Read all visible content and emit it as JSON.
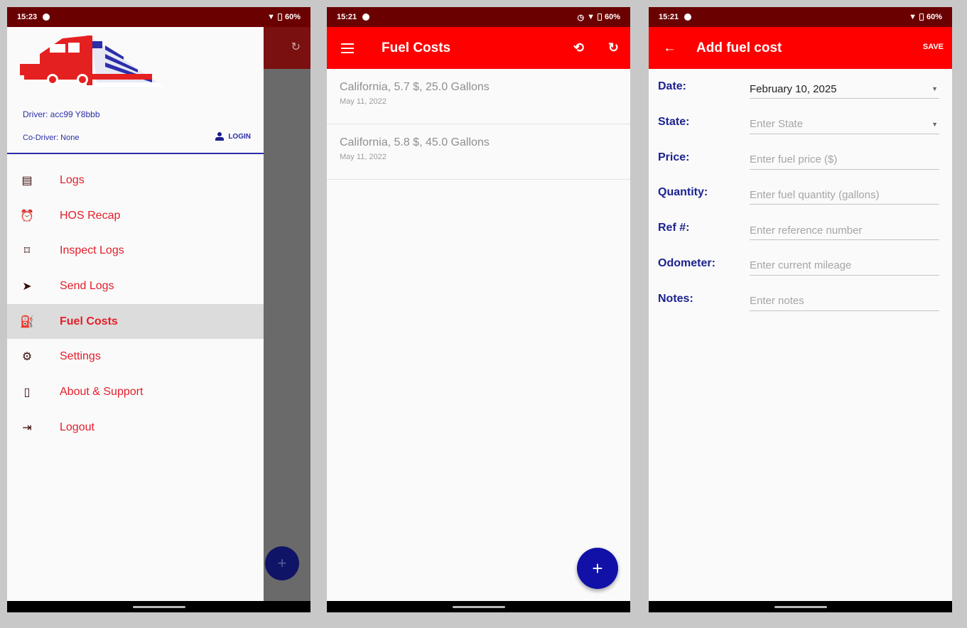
{
  "screens": [
    {
      "status": {
        "time": "15:23",
        "battery": "60%"
      },
      "drawer": {
        "driver": "Driver: acc99 Y8bbb",
        "codriver": "Co-Driver: None",
        "login_label": "LOGIN",
        "items": [
          {
            "label": "Logs",
            "icon": "logs-icon"
          },
          {
            "label": "HOS Recap",
            "icon": "alarm-clock-icon"
          },
          {
            "label": "Inspect Logs",
            "icon": "inspect-icon"
          },
          {
            "label": "Send Logs",
            "icon": "send-icon"
          },
          {
            "label": "Fuel Costs",
            "icon": "fuel-pump-icon",
            "active": true
          },
          {
            "label": "Settings",
            "icon": "gear-icon"
          },
          {
            "label": "About & Support",
            "icon": "phone-device-icon"
          },
          {
            "label": "Logout",
            "icon": "logout-icon"
          }
        ]
      }
    },
    {
      "status": {
        "time": "15:21",
        "battery": "60%"
      },
      "appbar": {
        "title": "Fuel Costs"
      },
      "entries": [
        {
          "title": "California, 5.7 $, 25.0 Gallons",
          "date": "May 11, 2022"
        },
        {
          "title": "California, 5.8 $, 45.0 Gallons",
          "date": "May 11, 2022"
        }
      ],
      "fab": "+"
    },
    {
      "status": {
        "time": "15:21",
        "battery": "60%"
      },
      "appbar": {
        "title": "Add fuel cost",
        "save_label": "SAVE"
      },
      "form": {
        "date": {
          "label": "Date:",
          "value": "February 10, 2025"
        },
        "state": {
          "label": "State:",
          "placeholder": "Enter State"
        },
        "price": {
          "label": "Price:",
          "placeholder": "Enter fuel price ($)"
        },
        "quantity": {
          "label": "Quantity:",
          "placeholder": "Enter fuel quantity (gallons)"
        },
        "ref": {
          "label": "Ref #:",
          "placeholder": "Enter reference number"
        },
        "odometer": {
          "label": "Odometer:",
          "placeholder": "Enter current mileage"
        },
        "notes": {
          "label": "Notes:",
          "placeholder": "Enter notes"
        }
      }
    }
  ],
  "colors": {
    "primary": "#ff0000",
    "status_bar": "#6b0000",
    "accent": "#1111a8",
    "label_blue": "#1c2390",
    "menu_red": "#e31e2a"
  }
}
